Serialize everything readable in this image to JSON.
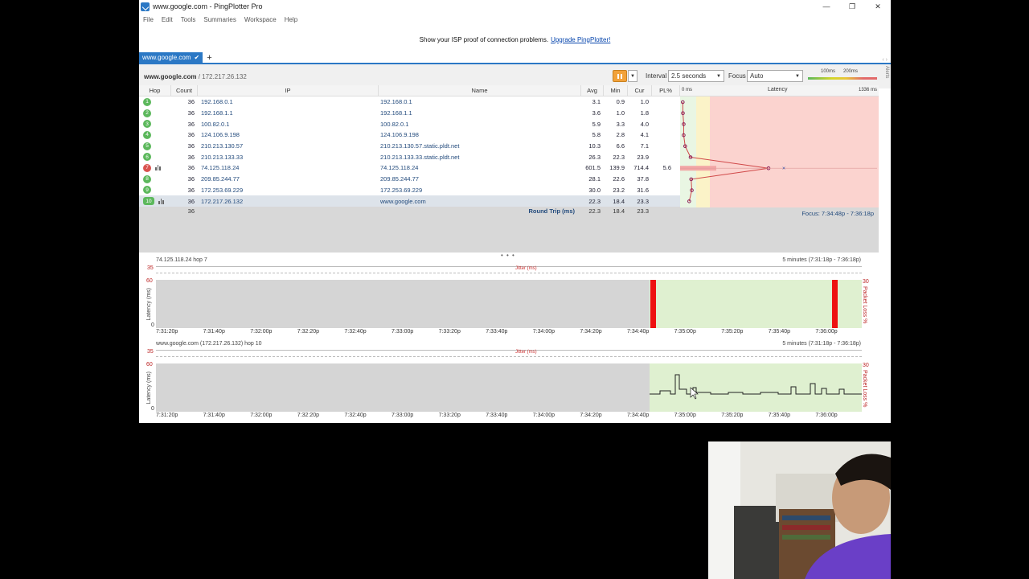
{
  "window": {
    "title": "www.google.com - PingPlotter Pro",
    "controls": [
      "—",
      "❐",
      "✕"
    ]
  },
  "menu": [
    "File",
    "Edit",
    "Tools",
    "Summaries",
    "Workspace",
    "Help"
  ],
  "banner": {
    "text": "Show your ISP proof of connection problems.",
    "link": "Upgrade PingPlotter!"
  },
  "tabs": [
    {
      "label": "www.google.com",
      "check": "✔"
    }
  ],
  "tab_add": "+",
  "tab_nav": "‹  ›",
  "toolbar": {
    "target_host": "www.google.com",
    "target_ip": " / 172.217.26.132",
    "interval_label": "Interval",
    "interval_value": "2.5 seconds",
    "focus_label": "Focus",
    "focus_value": "Auto",
    "scale_100": "100ms",
    "scale_200": "200ms",
    "alerts": "Alerts"
  },
  "table": {
    "headers": {
      "hop": "Hop",
      "count": "Count",
      "ip": "IP",
      "name": "Name",
      "avg": "Avg",
      "min": "Min",
      "cur": "Cur",
      "pl": "PL%",
      "latency": "Latency",
      "lat_min": "0 ms",
      "lat_max": "1336 ms"
    },
    "rows": [
      {
        "hop": "1",
        "count": "36",
        "ip": "192.168.0.1",
        "name": "192.168.0.1",
        "avg": "3.1",
        "min": "0.9",
        "cur": "1.0",
        "pl": "",
        "lat": 3.1
      },
      {
        "hop": "2",
        "count": "36",
        "ip": "192.168.1.1",
        "name": "192.168.1.1",
        "avg": "3.6",
        "min": "1.0",
        "cur": "1.8",
        "pl": "",
        "lat": 3.6
      },
      {
        "hop": "3",
        "count": "36",
        "ip": "100.82.0.1",
        "name": "100.82.0.1",
        "avg": "5.9",
        "min": "3.3",
        "cur": "4.0",
        "pl": "",
        "lat": 5.9
      },
      {
        "hop": "4",
        "count": "36",
        "ip": "124.106.9.198",
        "name": "124.106.9.198",
        "avg": "5.8",
        "min": "2.8",
        "cur": "4.1",
        "pl": "",
        "lat": 5.8
      },
      {
        "hop": "5",
        "count": "36",
        "ip": "210.213.130.57",
        "name": "210.213.130.57.static.pldt.net",
        "avg": "10.3",
        "min": "6.6",
        "cur": "7.1",
        "pl": "",
        "lat": 10.3
      },
      {
        "hop": "6",
        "count": "36",
        "ip": "210.213.133.33",
        "name": "210.213.133.33.static.pldt.net",
        "avg": "26.3",
        "min": "22.3",
        "cur": "23.9",
        "pl": "",
        "lat": 26.3
      },
      {
        "hop": "7",
        "count": "36",
        "ip": "74.125.118.24",
        "name": "74.125.118.24",
        "avg": "601.5",
        "min": "139.9",
        "cur": "714.4",
        "pl": "5.6",
        "lat": 601.5,
        "bad": true,
        "graph": true
      },
      {
        "hop": "8",
        "count": "36",
        "ip": "209.85.244.77",
        "name": "209.85.244.77",
        "avg": "28.1",
        "min": "22.6",
        "cur": "37.8",
        "pl": "",
        "lat": 28.1
      },
      {
        "hop": "9",
        "count": "36",
        "ip": "172.253.69.229",
        "name": "172.253.69.229",
        "avg": "30.0",
        "min": "23.2",
        "cur": "31.6",
        "pl": "",
        "lat": 30.0
      },
      {
        "hop": "10",
        "count": "36",
        "ip": "172.217.26.132",
        "name": "www.google.com",
        "avg": "22.3",
        "min": "18.4",
        "cur": "23.3",
        "pl": "",
        "lat": 22.3,
        "graph": true,
        "selected": true
      }
    ],
    "round_trip": {
      "count": "36",
      "label": "Round Trip (ms)",
      "avg": "22.3",
      "min": "18.4",
      "cur": "23.3"
    },
    "focus_text": "Focus: 7:34:48p - 7:36:18p"
  },
  "splitter": "• • •",
  "timegraphs": [
    {
      "title": "74.125.118.24 hop 7",
      "range": "5 minutes (7:31:18p - 7:36:18p)",
      "jitter_label": "Jitter (ms)",
      "y_top": "35",
      "y_max": "60",
      "y_zero": "0",
      "pl_max": "30",
      "ylabel": "Latency (ms)",
      "y2label": "Packet Loss %",
      "ticks": [
        "7:31:20p",
        "7:31:40p",
        "7:32:00p",
        "7:32:20p",
        "7:32:40p",
        "7:33:00p",
        "7:33:20p",
        "7:33:40p",
        "7:34:00p",
        "7:34:20p",
        "7:34:40p",
        "7:35:00p",
        "7:35:20p",
        "7:35:40p",
        "7:36:00p"
      ]
    },
    {
      "title": "www.google.com (172.217.26.132) hop 10",
      "range": "5 minutes (7:31:18p - 7:36:18p)",
      "jitter_label": "Jitter (ms)",
      "y_top": "35",
      "y_max": "60",
      "y_zero": "0",
      "pl_max": "30",
      "ylabel": "Latency (ms)",
      "y2label": "Packet Loss %",
      "ticks": [
        "7:31:20p",
        "7:31:40p",
        "7:32:00p",
        "7:32:20p",
        "7:32:40p",
        "7:33:00p",
        "7:33:20p",
        "7:33:40p",
        "7:34:00p",
        "7:34:20p",
        "7:34:40p",
        "7:35:00p",
        "7:35:20p",
        "7:35:40p",
        "7:36:00p"
      ]
    }
  ],
  "colors": {
    "accent": "#2b78c5",
    "good": "#5cb85c",
    "bad": "#d9534f",
    "loss": "#ee1111"
  }
}
